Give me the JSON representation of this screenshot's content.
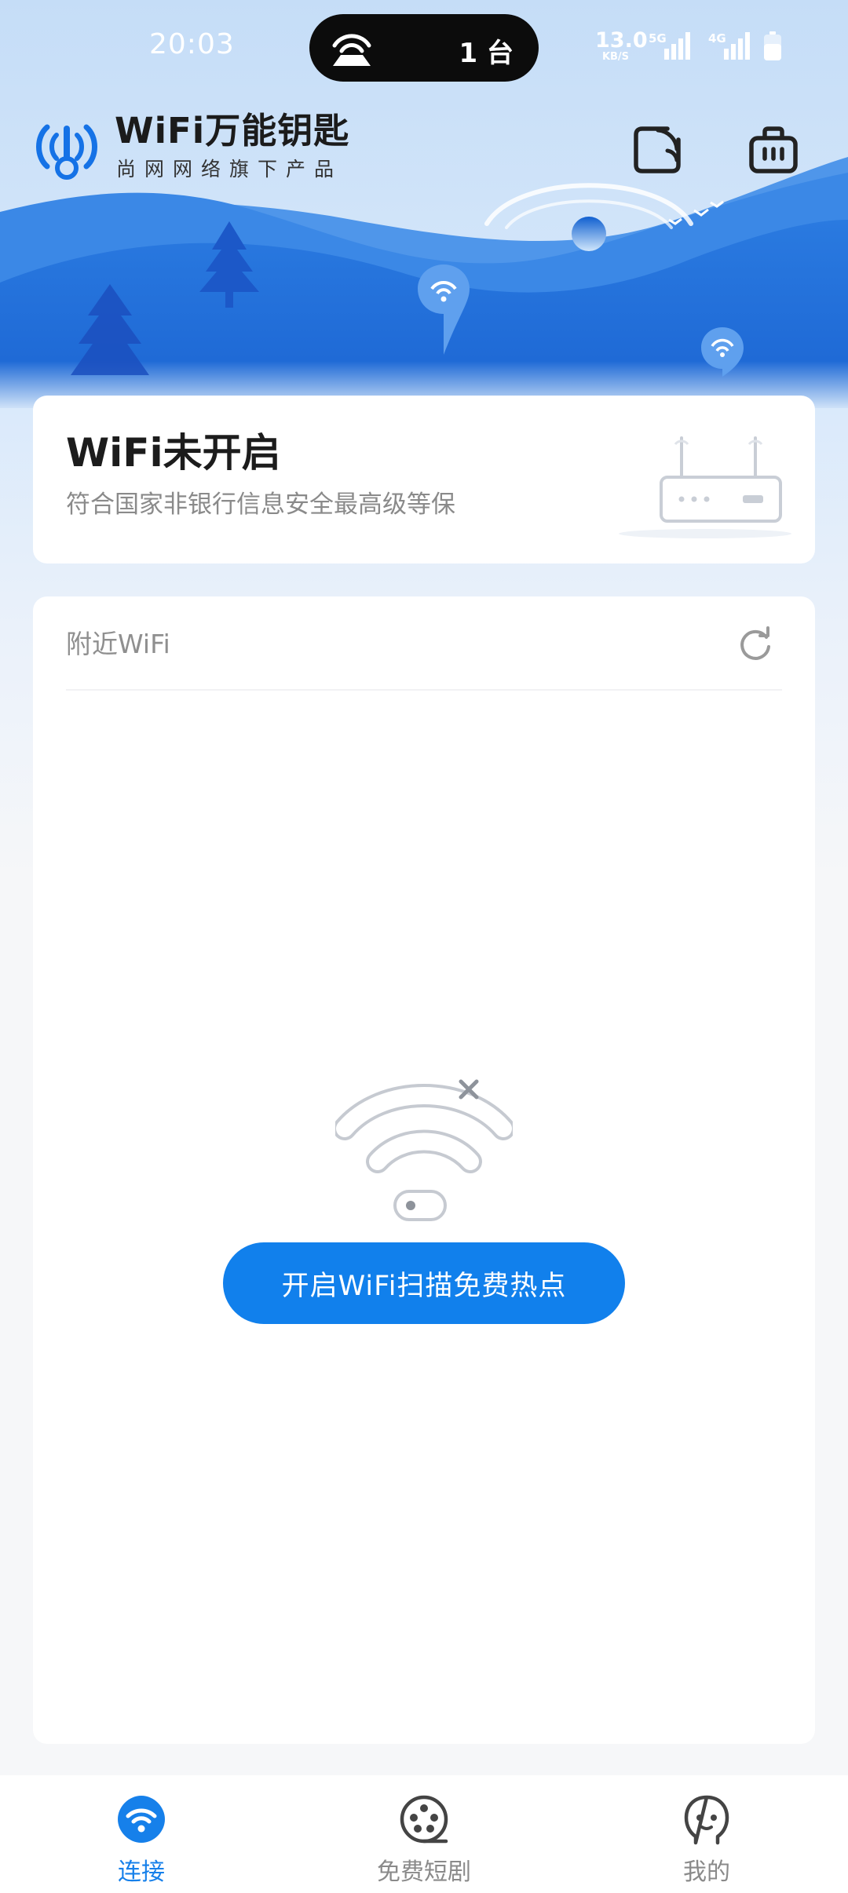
{
  "status_bar": {
    "time": "20:03",
    "hotspot_devices": "1 台",
    "net_speed_value": "13.0",
    "net_speed_unit": "KB/S",
    "network_5g": "5G",
    "network_4g": "4G"
  },
  "header": {
    "app_name": "WiFi万能钥匙",
    "app_subtitle": "尚网网络旗下产品",
    "scan_button_icon": "scan-icon",
    "toolbox_button_icon": "toolbox-icon"
  },
  "status_card": {
    "title": "WiFi未开启",
    "subtitle": "符合国家非银行信息安全最高级等保"
  },
  "nearby": {
    "title": "附近WiFi",
    "refresh_icon": "refresh-icon",
    "empty_icon": "wifi-off-icon",
    "action_button": "开启WiFi扫描免费热点"
  },
  "tabbar": {
    "tabs": [
      {
        "label": "连接",
        "icon": "wifi-icon",
        "active": true
      },
      {
        "label": "免费短剧",
        "icon": "film-reel-icon",
        "active": false
      },
      {
        "label": "我的",
        "icon": "profile-icon",
        "active": false
      }
    ]
  },
  "colors": {
    "accent": "#1180ec",
    "active_tab": "#1680ea",
    "sky_light": "#c5ddf7",
    "hill_blue": "#2b7de3"
  }
}
